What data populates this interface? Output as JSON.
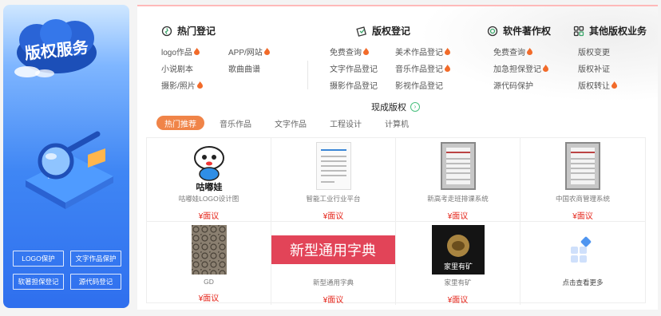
{
  "banner": {
    "logo_text": "版权服务",
    "buttons": [
      "LOGO保护",
      "文字作品保护",
      "软著担保登记",
      "源代码登记"
    ]
  },
  "categories": [
    {
      "title": "热门登记",
      "icon": "hot-register-icon",
      "items": [
        {
          "label": "logo作品",
          "hot": true
        },
        {
          "label": "APP/网站",
          "hot": true
        },
        {
          "label": "小说剧本",
          "hot": false
        },
        {
          "label": "歌曲曲谱",
          "hot": false
        },
        {
          "label": "摄影/照片",
          "hot": true
        }
      ]
    },
    {
      "title": "版权登记",
      "icon": "copyright-register-icon",
      "items": [
        {
          "label": "免费查询",
          "hot": true
        },
        {
          "label": "美术作品登记",
          "hot": true
        },
        {
          "label": "文字作品登记",
          "hot": false
        },
        {
          "label": "音乐作品登记",
          "hot": true
        },
        {
          "label": "摄影作品登记",
          "hot": false
        },
        {
          "label": "影视作品登记",
          "hot": false
        }
      ]
    },
    {
      "title": "软件著作权",
      "icon": "software-copyright-icon",
      "items": [
        {
          "label": "免费查询",
          "hot": true
        },
        {
          "label": "加急担保登记",
          "hot": true
        },
        {
          "label": "源代码保护",
          "hot": false
        }
      ]
    },
    {
      "title": "其他版权业务",
      "icon": "grid-icon",
      "items": [
        {
          "label": "版权变更",
          "hot": false
        },
        {
          "label": "版权补证",
          "hot": false
        },
        {
          "label": "版权转让",
          "hot": true
        }
      ]
    }
  ],
  "section": {
    "title": "现成版权"
  },
  "tabs": [
    "热门推荐",
    "音乐作品",
    "文字作品",
    "工程设计",
    "计算机"
  ],
  "active_tab": 0,
  "products": [
    {
      "title": "咕嘟娃LOGO设计图",
      "price": "¥面议",
      "thumb": "mascot",
      "thumb_text": "咕嘟娃"
    },
    {
      "title": "智能工业行业平台",
      "price": "¥面议",
      "thumb": "cert"
    },
    {
      "title": "新高考走班排课系统",
      "price": "¥面议",
      "thumb": "cert-photo"
    },
    {
      "title": "中国农商管理系统",
      "price": "¥面议",
      "thumb": "cert-photo"
    },
    {
      "title": "GD",
      "price": "¥面议",
      "thumb": "pattern"
    },
    {
      "title": "新型通用字典",
      "price": "¥面议",
      "thumb": "banner-text",
      "thumb_text": "新型通用字典"
    },
    {
      "title": "家里有矿",
      "price": "¥面议",
      "thumb": "mine",
      "thumb_text": "家里有矿"
    },
    {
      "title": "点击查看更多",
      "price": "",
      "thumb": "more"
    }
  ],
  "colors": {
    "accent": "#f08448",
    "price": "#e5261b",
    "banner": "#3f86f4"
  }
}
